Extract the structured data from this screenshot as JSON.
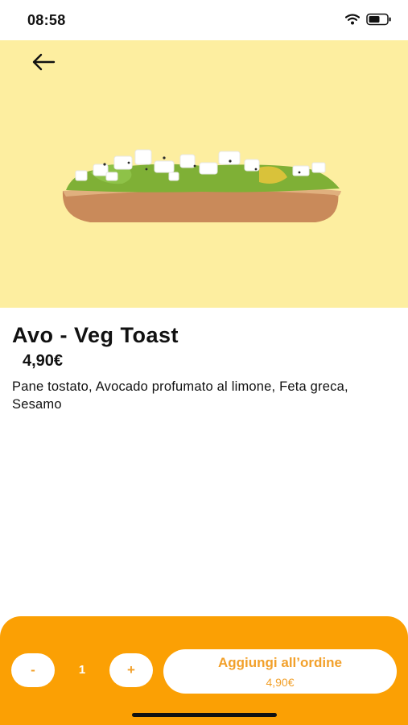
{
  "status": {
    "time": "08:58"
  },
  "product": {
    "title": "Avo - Veg Toast",
    "price": "4,90€",
    "description": "Pane tostato, Avocado profumato al limone, Feta greca, Sesamo"
  },
  "order": {
    "minus_label": "-",
    "quantity": "1",
    "plus_label": "+",
    "add_label": "Aggiungi all’ordine",
    "add_price": "4,90€"
  },
  "colors": {
    "hero_bg": "#fdeea0",
    "accent": "#fba004",
    "accent_text": "#f2a02a"
  },
  "icons": [
    "back-arrow-icon",
    "wifi-icon",
    "battery-icon"
  ]
}
